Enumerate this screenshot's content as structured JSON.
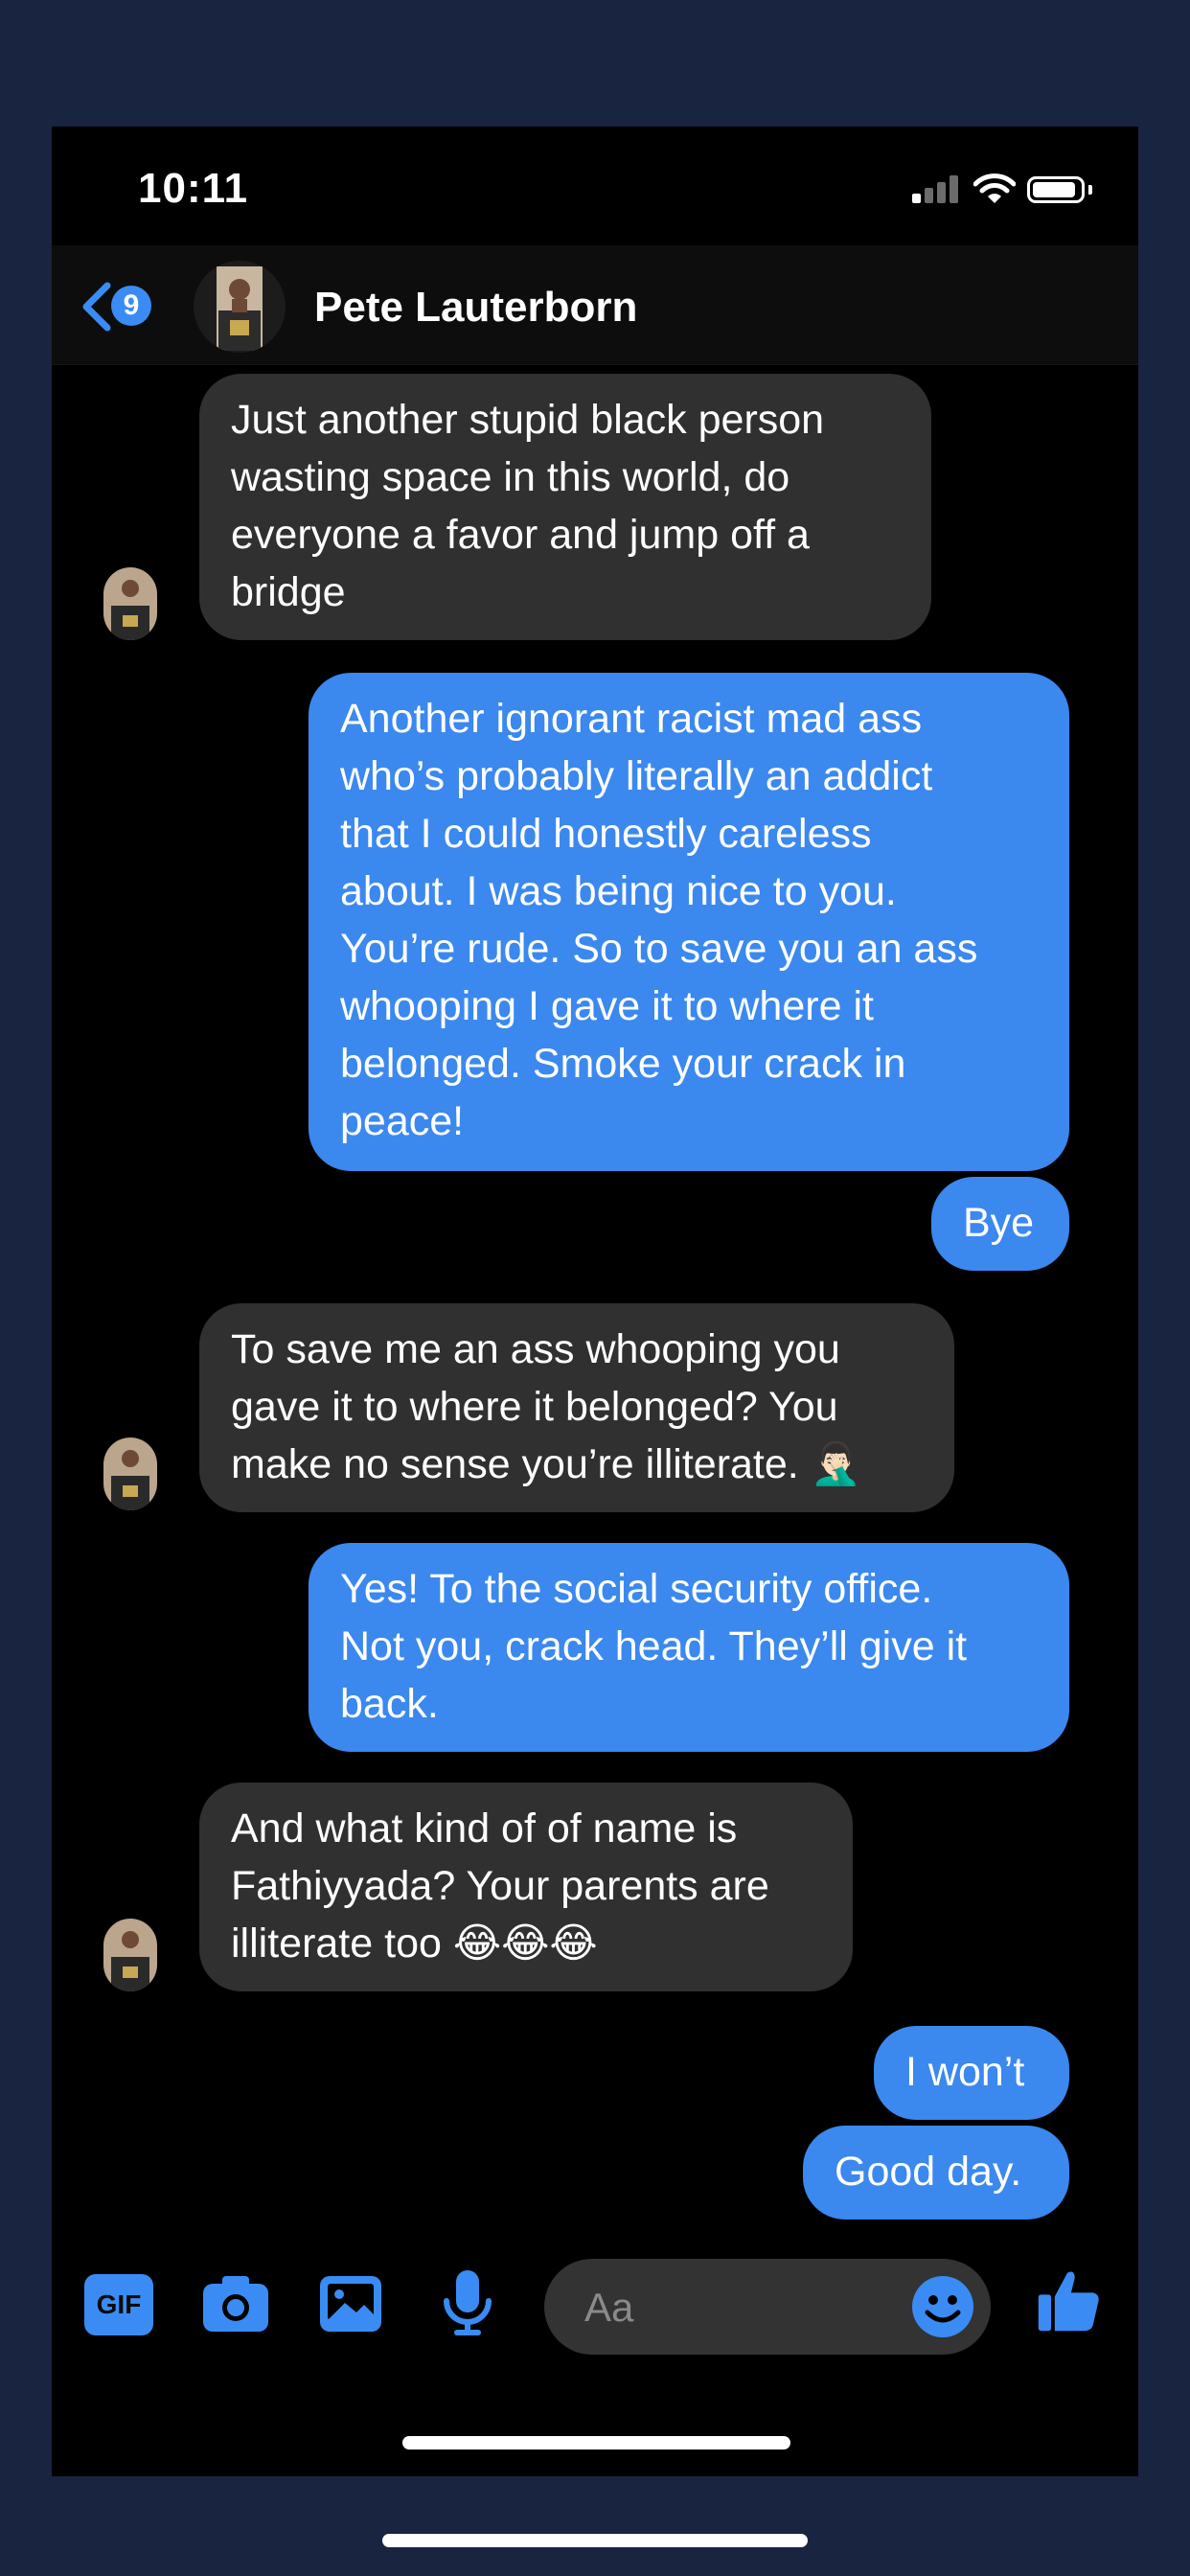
{
  "status_bar": {
    "time": "10:11",
    "icons": [
      "cellular-signal-icon",
      "wifi-icon",
      "battery-icon"
    ]
  },
  "header": {
    "back_badge": "9",
    "contact_name": "Pete Lauterborn"
  },
  "messages": [
    {
      "direction": "incoming",
      "lines": [
        "Just another stupid black person",
        "wasting space in this world, do",
        "everyone a favor and jump off a",
        "bridge"
      ]
    },
    {
      "direction": "outgoing",
      "lines": [
        "Another ignorant racist mad ass",
        "who’s probably literally an addict",
        "that I could honestly careless",
        "about. I was being nice to you.",
        "You’re rude. So to save you an ass",
        "whooping I gave it to where it",
        "belonged. Smoke your crack in",
        "peace!"
      ]
    },
    {
      "direction": "outgoing",
      "lines": [
        "Bye"
      ]
    },
    {
      "direction": "incoming",
      "lines": [
        "To save me an ass whooping you",
        "gave it to where it belonged? You",
        "make no sense you’re illiterate. 🤦🏻‍♂️"
      ]
    },
    {
      "direction": "outgoing",
      "lines": [
        "Yes! To the social security office.",
        "Not you, crack head. They’ll give it",
        "back."
      ]
    },
    {
      "direction": "incoming",
      "lines": [
        "And what kind of of name is",
        "Fathiyyada? Your parents are",
        "illiterate too 😂😂😂"
      ]
    },
    {
      "direction": "outgoing",
      "lines": [
        "I won’t"
      ]
    },
    {
      "direction": "outgoing",
      "lines": [
        "Good day."
      ]
    }
  ],
  "composer": {
    "gif_label": "GIF",
    "placeholder": "Aa"
  },
  "colors": {
    "outer_background": "#182440",
    "outgoing_bubble": "#3b88ef",
    "incoming_bubble": "#303030",
    "accent": "#3a8cf4"
  }
}
